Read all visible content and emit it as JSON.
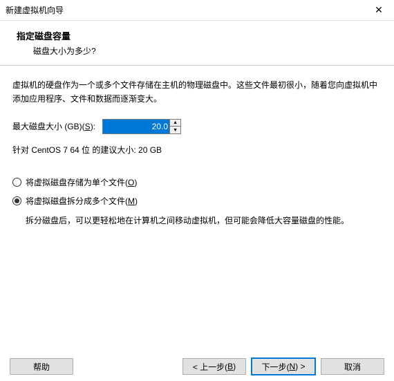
{
  "window": {
    "title": "新建虚拟机向导"
  },
  "header": {
    "title": "指定磁盘容量",
    "subtitle": "磁盘大小为多少?"
  },
  "description": "虚拟机的硬盘作为一个或多个文件存储在主机的物理磁盘中。这些文件最初很小，随着您向虚拟机中添加应用程序、文件和数据而逐渐变大。",
  "disk": {
    "label_prefix": "最大磁盘大小 (GB)(",
    "label_mnemonic": "S",
    "label_suffix": "):",
    "value": "20.0",
    "recommendation": "针对 CentOS 7 64 位 的建议大小: 20 GB"
  },
  "options": {
    "single": {
      "prefix": "将虚拟磁盘存储为单个文件(",
      "mnemonic": "O",
      "suffix": ")",
      "checked": false
    },
    "split": {
      "prefix": "将虚拟磁盘拆分成多个文件(",
      "mnemonic": "M",
      "suffix": ")",
      "checked": true
    },
    "split_desc": "拆分磁盘后，可以更轻松地在计算机之间移动虚拟机，但可能会降低大容量磁盘的性能。"
  },
  "buttons": {
    "help": "帮助",
    "back_prefix": "< 上一步(",
    "back_mnemonic": "B",
    "back_suffix": ")",
    "next_prefix": "下一步(",
    "next_mnemonic": "N",
    "next_suffix": ") >",
    "cancel": "取消"
  }
}
